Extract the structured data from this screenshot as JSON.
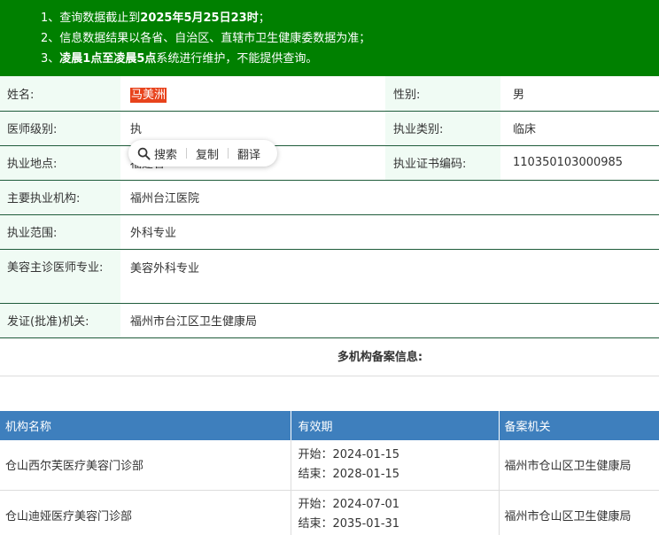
{
  "notice": {
    "line1_prefix": "1、查询数据截止到",
    "line1_bold": "2025年5月25日23时",
    "line1_suffix": "；",
    "line2": "2、信息数据结果以各省、自治区、直辖市卫生健康委数据为准；",
    "line3_prefix": "3、",
    "line3_bold": "凌晨1点至凌晨5点",
    "line3_suffix": "系统进行维护，不能提供查询。"
  },
  "info": {
    "name_label": "姓名:",
    "name_value": "马美洲",
    "gender_label": "性别:",
    "gender_value": "男",
    "level_label": "医师级别:",
    "level_value": "执",
    "category_label": "执业类别:",
    "category_value": "临床",
    "location_label": "执业地点:",
    "location_value": "福建省",
    "cert_label": "执业证书编码:",
    "cert_value": "110350103000985",
    "org_label": "主要执业机构:",
    "org_value": "福州台江医院",
    "scope_label": "执业范围:",
    "scope_value": "外科专业",
    "cosmetic_label": "美容主诊医师专业:",
    "cosmetic_value": "美容外科专业",
    "issuer_label": "发证(批准)机关:",
    "issuer_value": "福州市台江区卫生健康局"
  },
  "popup": {
    "search": "搜索",
    "copy": "复制",
    "translate": "翻译"
  },
  "multi_title": "多机构备案信息:",
  "org_table": {
    "headers": [
      "机构名称",
      "有效期",
      "备案机关"
    ],
    "rows": [
      {
        "name": "仓山西尔芙医疗美容门诊部",
        "start": "开始：2024-01-15",
        "end": "结束：2028-01-15",
        "authority": "福州市仓山区卫生健康局"
      },
      {
        "name": "仓山迪娅医疗美容门诊部",
        "start": "开始：2024-07-01",
        "end": "结束：2035-01-31",
        "authority": "福州市仓山区卫生健康局"
      }
    ]
  }
}
